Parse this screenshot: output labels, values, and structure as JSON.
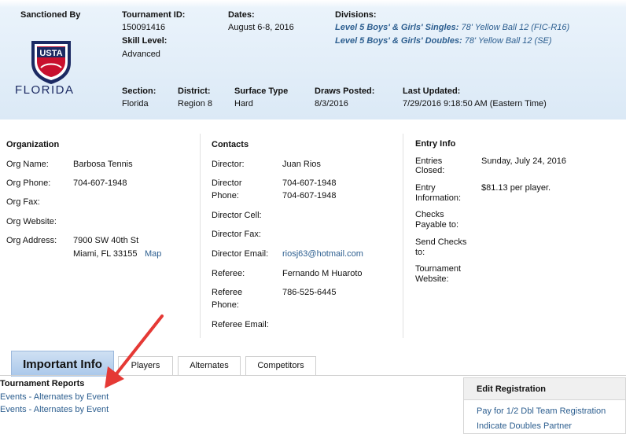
{
  "header": {
    "sanctioned_by_label": "Sanctioned By",
    "logo_text": "USTA",
    "state_text": "FLORIDA",
    "tournament_id_label": "Tournament ID:",
    "tournament_id": "150091416",
    "skill_level_label": "Skill Level:",
    "skill_level": "Advanced",
    "dates_label": "Dates:",
    "dates": "August 6-8, 2016",
    "divisions_label": "Divisions:",
    "divisions": [
      {
        "level": "Level 5 Boys' & Girls' Singles:",
        "detail": "78' Yellow Ball 12 (FIC-R16)"
      },
      {
        "level": "Level 5 Boys' & Girls' Doubles:",
        "detail": "78' Yellow Ball 12 (SE)"
      }
    ],
    "section_label": "Section:",
    "section": "Florida",
    "district_label": "District:",
    "district": "Region 8",
    "surface_label": "Surface Type",
    "surface": "Hard",
    "draws_posted_label": "Draws Posted:",
    "draws_posted": "8/3/2016",
    "last_updated_label": "Last Updated:",
    "last_updated": "7/29/2016 9:18:50 AM (Eastern Time)"
  },
  "organization": {
    "title": "Organization",
    "name_label": "Org Name:",
    "name": "Barbosa Tennis",
    "phone_label": "Org Phone:",
    "phone": "704-607-1948",
    "fax_label": "Org Fax:",
    "website_label": "Org Website:",
    "address_label": "Org Address:",
    "address_line1": "7900 SW 40th St",
    "address_line2": "Miami, FL 33155",
    "map_link": "Map"
  },
  "contacts": {
    "title": "Contacts",
    "director_label": "Director:",
    "director": "Juan Rios",
    "director_phone_label_1": "Director",
    "director_phone_label_2": "Phone:",
    "director_phone_1": "704-607-1948",
    "director_phone_2": "704-607-1948",
    "director_cell_label": "Director Cell:",
    "director_fax_label": "Director Fax:",
    "director_email_label": "Director Email:",
    "director_email": "riosj63@hotmail.com",
    "referee_label": "Referee:",
    "referee": "Fernando M Huaroto",
    "referee_phone_label_1": "Referee",
    "referee_phone_label_2": "Phone:",
    "referee_phone": "786-525-6445",
    "referee_email_label": "Referee Email:"
  },
  "entry_info": {
    "title": "Entry Info",
    "closed_label_1": "Entries",
    "closed_label_2": "Closed:",
    "closed": "Sunday, July 24, 2016",
    "information_label_1": "Entry",
    "information_label_2": "Information:",
    "information": "$81.13 per player.",
    "checks_payable_label_1": "Checks",
    "checks_payable_label_2": "Payable to:",
    "send_checks_label_1": "Send Checks",
    "send_checks_label_2": "to:",
    "website_label_1": "Tournament",
    "website_label_2": "Website:"
  },
  "tabs": {
    "important_info": "Important Info",
    "players": "Players",
    "alternates": "Alternates",
    "competitors": "Competitors"
  },
  "reports": {
    "title": "Tournament Reports",
    "links": [
      "Events - Alternates by Event",
      "Events - Alternates by Event"
    ]
  },
  "edit_registration": {
    "title": "Edit Registration",
    "links": [
      "Pay for 1/2 Dbl Team Registration",
      "Indicate Doubles Partner"
    ]
  },
  "colors": {
    "link": "#2c5e8f",
    "annotation_arrow": "#e53935",
    "usta_red": "#c8102e",
    "usta_navy": "#1c2a63"
  }
}
